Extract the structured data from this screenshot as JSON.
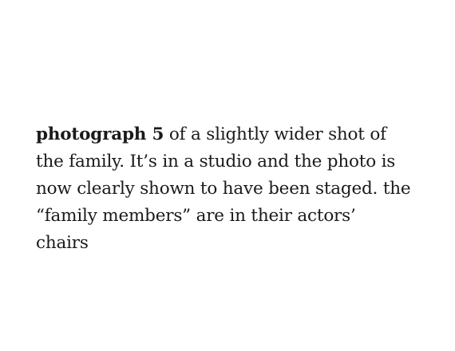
{
  "caption": {
    "lead": "photograph 5",
    "body": " of a slightly wider shot of the family. It’s in a studio and the photo is now clearly shown to have been staged. the “family members” are in their actors’ chairs"
  }
}
